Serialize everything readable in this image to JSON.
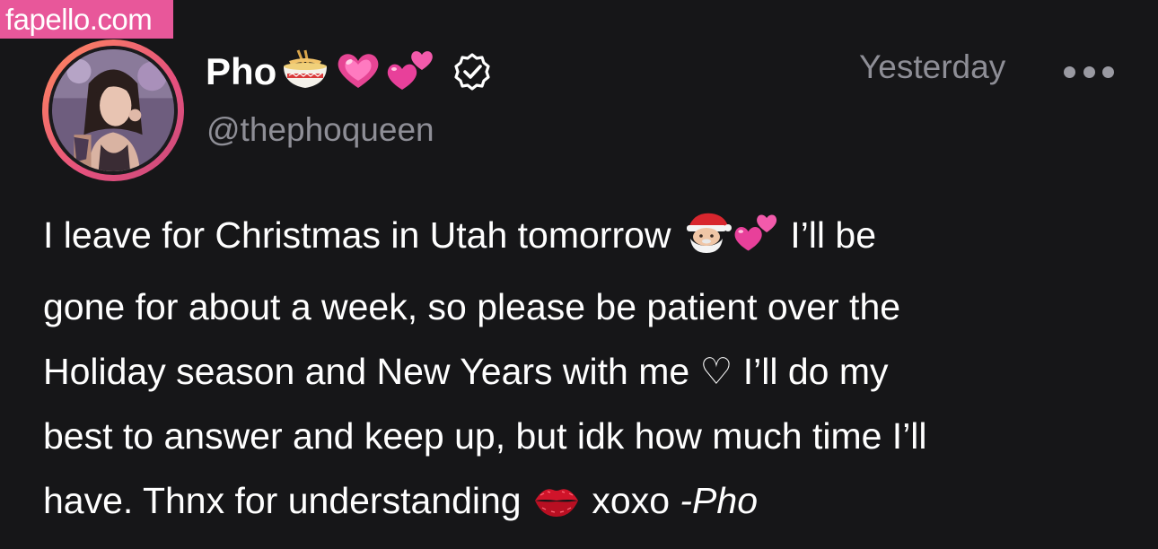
{
  "watermark": {
    "text": "fapello.com"
  },
  "profile": {
    "display_name": "Pho",
    "name_emojis": [
      "noodle-bowl-icon",
      "pink-heart-icon",
      "two-hearts-icon"
    ],
    "handle": "@thephoqueen",
    "verified": true
  },
  "post": {
    "timestamp": "Yesterday",
    "lines": [
      {
        "before": "I leave for Christmas in Utah tomorrow ",
        "after": " I’ll be"
      },
      {
        "text": "gone for about a week, so please be patient over the"
      },
      {
        "text": "Holiday season and New Years with me ♡ I’ll do my"
      },
      {
        "text": "best to answer and keep up, but idk how much time I’ll"
      },
      {
        "before": "have. Thnx for understanding ",
        "middle": " xoxo ",
        "signature": "-Pho"
      }
    ],
    "inline_emojis": [
      "santa-icon",
      "two-hearts-icon",
      "kiss-mark-icon"
    ]
  },
  "colors": {
    "background": "#161618",
    "text": "#ffffff",
    "muted": "#8e8e96",
    "watermark": "#e8579a",
    "avatar_ring": "#e6517e"
  }
}
